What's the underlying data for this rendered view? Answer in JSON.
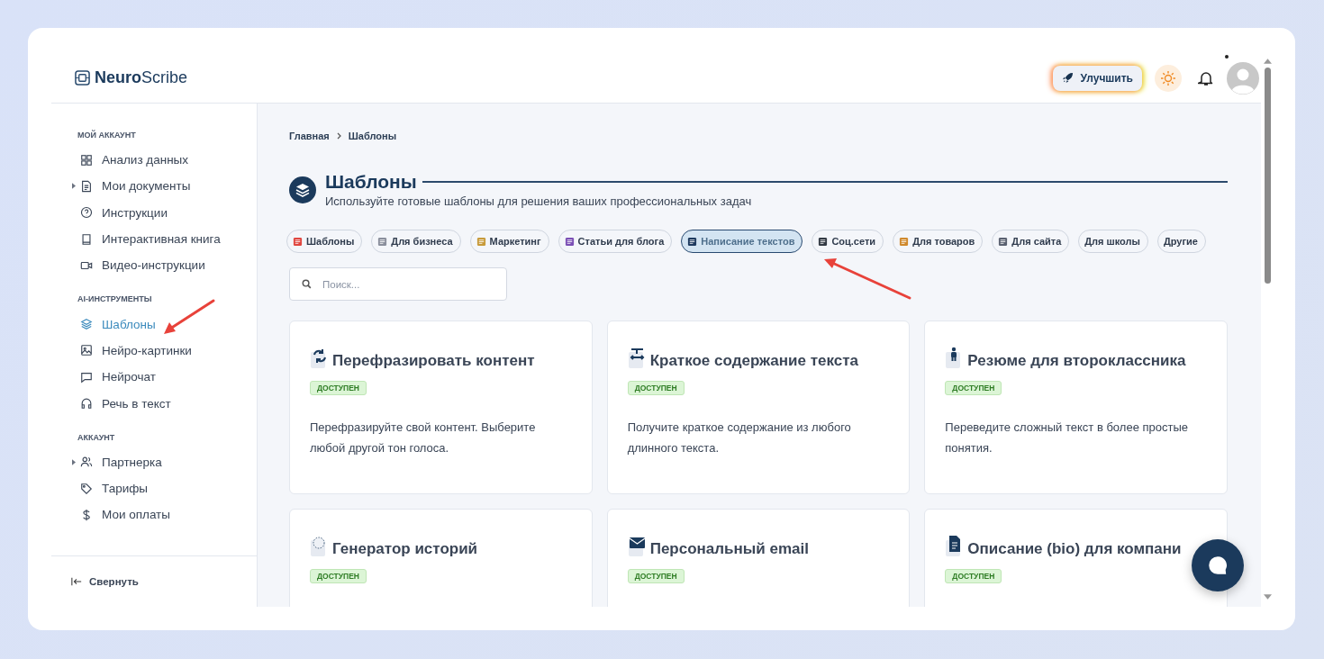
{
  "header": {
    "logo": {
      "strong": "Neuro",
      "light": "Scribe"
    },
    "upgrade_button": "Улучшить"
  },
  "sidebar": {
    "sections": [
      {
        "title": "МОЙ АККАУНТ",
        "items": [
          {
            "label": "Анализ данных",
            "expandable": false,
            "selected": false
          },
          {
            "label": "Мои документы",
            "expandable": true,
            "selected": false
          },
          {
            "label": "Инструкции",
            "expandable": false,
            "selected": false
          },
          {
            "label": "Интерактивная книга",
            "expandable": false,
            "selected": false
          },
          {
            "label": "Видео-инструкции",
            "expandable": false,
            "selected": false
          }
        ]
      },
      {
        "title": "AI-ИНСТРУМЕНТЫ",
        "items": [
          {
            "label": "Шаблоны",
            "expandable": false,
            "selected": true
          },
          {
            "label": "Нейро-картинки",
            "expandable": false,
            "selected": false
          },
          {
            "label": "Нейрочат",
            "expandable": false,
            "selected": false
          },
          {
            "label": "Речь в текст",
            "expandable": false,
            "selected": false
          }
        ]
      },
      {
        "title": "АККАУНТ",
        "items": [
          {
            "label": "Партнерка",
            "expandable": true,
            "selected": false
          },
          {
            "label": "Тарифы",
            "expandable": false,
            "selected": false
          },
          {
            "label": "Мои оплаты",
            "expandable": false,
            "selected": false
          }
        ]
      }
    ],
    "collapse": "Свернуть"
  },
  "breadcrumb": [
    "Главная",
    "Шаблоны"
  ],
  "page": {
    "title": "Шаблоны",
    "subtitle": "Используйте готовые шаблоны для решения ваших профессиональных задач"
  },
  "categories": [
    {
      "label": "Шаблоны",
      "selected": false
    },
    {
      "label": "Для бизнеса",
      "selected": false
    },
    {
      "label": "Маркетинг",
      "selected": false
    },
    {
      "label": "Статьи для блога",
      "selected": false
    },
    {
      "label": "Написание текстов",
      "selected": true
    },
    {
      "label": "Соц.сети",
      "selected": false
    },
    {
      "label": "Для товаров",
      "selected": false
    },
    {
      "label": "Для сайта",
      "selected": false
    },
    {
      "label": "Для школы",
      "selected": false
    },
    {
      "label": "Другие",
      "selected": false
    }
  ],
  "search": {
    "placeholder": "Поиск..."
  },
  "cards": [
    {
      "title": "Перефразировать контент",
      "badge": "ДОСТУПЕН",
      "description": "Перефразируйте свой контент. Выберите любой другой тон голоса."
    },
    {
      "title": "Краткое содержание текста",
      "badge": "ДОСТУПЕН",
      "description": "Получите краткое содержание из любого длинного текста."
    },
    {
      "title": "Резюме для второклассника",
      "badge": "ДОСТУПЕН",
      "description": "Переведите сложный текст в более простые понятия."
    },
    {
      "title": "Генератор историй",
      "badge": "ДОСТУПЕН"
    },
    {
      "title": "Персональный email",
      "badge": "ДОСТУПЕН"
    },
    {
      "title": "Описание (bio) для компани",
      "badge": "ДОСТУПЕН"
    }
  ]
}
